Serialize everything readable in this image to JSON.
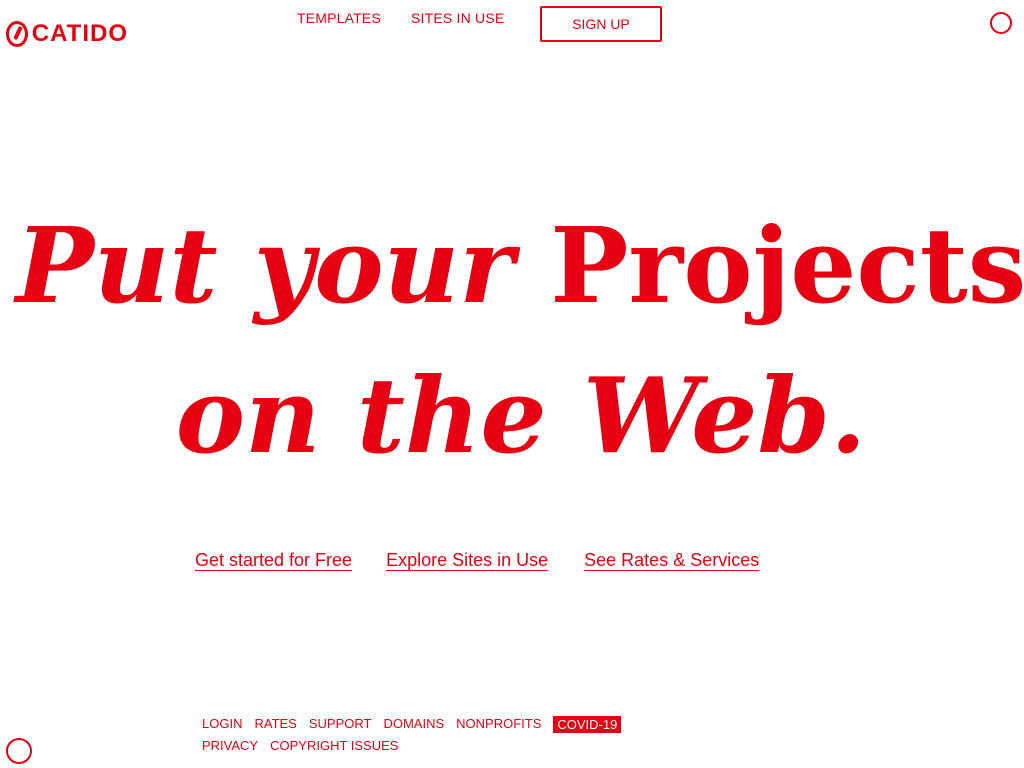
{
  "logo": {
    "text": "CATIDO"
  },
  "top_nav": {
    "items": [
      "TEMPLATES",
      "SITES IN USE"
    ],
    "button_label": "SIGN UP"
  },
  "hero": {
    "line1_italic": "Put your",
    "line1_roman": "Projects",
    "line2": "on the Web."
  },
  "cta": {
    "links": [
      "Get started for Free",
      "Explore Sites in Use",
      "See Rates & Services"
    ]
  },
  "footer": {
    "row1": [
      "LOGIN",
      "RATES",
      "SUPPORT",
      "DOMAINS",
      "NONPROFITS"
    ],
    "badge": "COVID-19",
    "row2": [
      "PRIVACY",
      "COPYRIGHT ISSUES"
    ]
  },
  "colors": {
    "accent": "#e60012",
    "background": "#ffffff"
  }
}
